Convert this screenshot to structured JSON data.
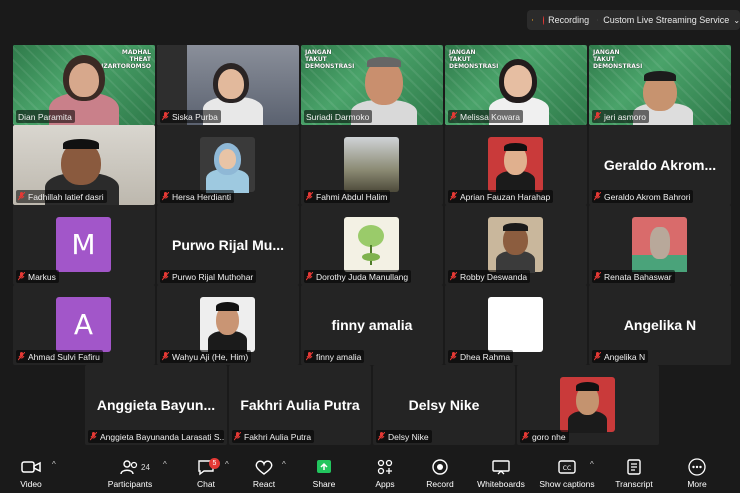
{
  "status": {
    "recording_label": "Recording",
    "stream_label": "Custom Live Streaming Service"
  },
  "banners": {
    "t1": "MADHAL\nTHEAT\nIZARTOROMSO",
    "t3": "JANGAN\nTAKUT\nDEMONSTRASI",
    "t4": "JANGAN\nTAKUT\nDEMONSTRASI",
    "t5": "JANGAN\nTAKUT\nDEMONSTRASI"
  },
  "participants": [
    {
      "name": "Dian Paramita",
      "big": "",
      "avatar": "",
      "muted": false,
      "speaking": true
    },
    {
      "name": "Siska Purba",
      "big": "",
      "avatar": "",
      "muted": true
    },
    {
      "name": "Suriadi Darmoko",
      "big": "",
      "avatar": "",
      "muted": false
    },
    {
      "name": "Melissa Kowara",
      "big": "",
      "avatar": "",
      "muted": true
    },
    {
      "name": "jeri asmoro",
      "big": "",
      "avatar": "",
      "muted": true
    },
    {
      "name": "Fadhillah latief dasri",
      "big": "",
      "avatar": "",
      "muted": true
    },
    {
      "name": "Hersa Herdianti",
      "big": "",
      "avatar": "",
      "muted": true
    },
    {
      "name": "Fahmi Abdul Halim",
      "big": "",
      "avatar": "",
      "muted": true
    },
    {
      "name": "Aprian Fauzan Harahap",
      "big": "",
      "avatar": "",
      "muted": true
    },
    {
      "name": "Geraldo Akrom Bahrori",
      "big": "Geraldo  Akrom...",
      "avatar": "",
      "muted": true
    },
    {
      "name": "Markus",
      "big": "",
      "avatar": "M",
      "muted": true
    },
    {
      "name": "Purwo Rijal Muthohar",
      "big": "Purwo  Rijal  Mu...",
      "avatar": "",
      "muted": true
    },
    {
      "name": "Dorothy Juda Manullang",
      "big": "",
      "avatar": "",
      "muted": true
    },
    {
      "name": "Robby Deswanda",
      "big": "",
      "avatar": "",
      "muted": true
    },
    {
      "name": "Renata Bahaswar",
      "big": "",
      "avatar": "",
      "muted": true
    },
    {
      "name": "Ahmad Sulvi Fafiru",
      "big": "",
      "avatar": "A",
      "muted": true
    },
    {
      "name": "Wahyu Aji (He, Him)",
      "big": "",
      "avatar": "",
      "muted": true
    },
    {
      "name": "finny amalia",
      "big": "finny amalia",
      "avatar": "",
      "muted": true
    },
    {
      "name": "Dhea Rahma",
      "big": "",
      "avatar": "",
      "muted": true
    },
    {
      "name": "Angelika N",
      "big": "Angelika N",
      "avatar": "",
      "muted": true
    },
    {
      "name": "Anggieta Bayunanda Larasati S...",
      "big": "Anggieta  Bayun...",
      "avatar": "",
      "muted": true
    },
    {
      "name": "Fakhri Aulia Putra",
      "big": "Fakhri Aulia Putra",
      "avatar": "",
      "muted": true
    },
    {
      "name": "Delsy Nike",
      "big": "Delsy Nike",
      "avatar": "",
      "muted": true
    },
    {
      "name": "goro nhe",
      "big": "",
      "avatar": "",
      "muted": true
    }
  ],
  "toolbar": {
    "video": "Video",
    "participants": "Participants",
    "participants_count": "24",
    "chat": "Chat",
    "chat_badge": "5",
    "react": "React",
    "share": "Share",
    "apps": "Apps",
    "record": "Record",
    "whiteboards": "Whiteboards",
    "captions": "Show captions",
    "transcript": "Transcript",
    "more": "More"
  },
  "colors": {
    "speaking": "#2ecc71",
    "muted": "#e53935",
    "share": "#22c55e",
    "avatar_purple": "#a256c9"
  }
}
